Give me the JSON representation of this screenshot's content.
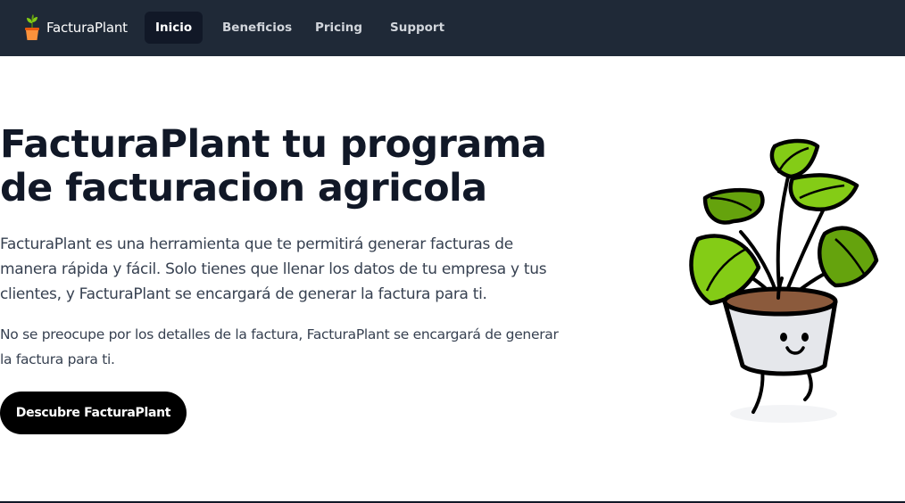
{
  "nav": {
    "brand": "FacturaPlant",
    "brand_icon": "potted-plant-icon",
    "items": [
      {
        "label": "Inicio",
        "active": true
      },
      {
        "label": "Beneficios",
        "active": false
      },
      {
        "label": "Pricing",
        "active": false
      },
      {
        "label": "Support",
        "active": false
      }
    ]
  },
  "hero": {
    "title": "FacturaPlant tu programa de facturacion agricola",
    "description": "FacturaPlant es una herramienta que te permitirá generar facturas de manera rápida y fácil. Solo tienes que llenar los datos de tu empresa y tus clientes, y FacturaPlant se encargará de generar la factura para ti.",
    "note": "No se preocupe por los detalles de la factura, FacturaPlant se encargará de generar la factura para ti.",
    "cta_label": "Descubre FacturaPlant",
    "illustration": "smiling-potted-plant-illustration"
  },
  "colors": {
    "navbar_bg": "#1f2937",
    "active_tab_bg": "#111827",
    "leaf_green": "#84cc16",
    "leaf_dark": "#65a30d",
    "pot": "#e5e7eb",
    "soil": "#8b5a3c",
    "button_bg": "#000000"
  }
}
